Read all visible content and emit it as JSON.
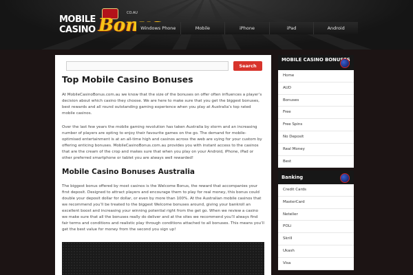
{
  "logo": {
    "line1": "MOBILE",
    "line2": "CASINO",
    "big": "Bonus",
    "cc": "CO.AU"
  },
  "nav": {
    "items": [
      "Windows Phone",
      "Mobile",
      "iPhone",
      "iPad",
      "Android"
    ]
  },
  "search": {
    "placeholder": "",
    "button_label": "Search"
  },
  "content": {
    "title": "Top Mobile Casino Bonuses",
    "p1": "At MobileCasinoBonus.com.au we know that the size of the bonuses on offer often influences a player’s decision about which casino they choose. We are here to make sure that you get the biggest bonuses, best rewards and all round outstanding gaming experience when you play at Australia’s top rated mobile casinos.",
    "p2": "Over the last few years the mobile gaming revolution has taken Australia by storm and an increasing number of players are opting to enjoy their favourite games on the go. The demand for mobile-optimised entertainment is at an all-time high and casinos across the web are vying for your custom by offering enticing bonuses. MobileCasinoBonus.com.au provides you with instant access to the casinos that are the cream of the crop and makes sure that when you play on your Android, iPhone, iPad or other preferred smartphone or tablet you are always well rewarded!",
    "subtitle": "Mobile Casino Bonuses Australia",
    "p3": "The biggest bonus offered by most casinos is the Welcome Bonus, the reward that accompanies your first deposit. Designed to attract players and encourage them to play for real money, this bonus could double your deposit dollar for dollar, or even by more than 100%. At the Australian mobile casinos that we recommend you’ll be treated to the biggest Welcome bonuses around, giving your bankroll an excellent boost and increasing your winning potential right from the get go. When we review a casino we make sure that all the bonuses really do deliver and at the sites we recommend you’ll always find fair terms and conditions and realistic play through conditions attached to all bonuses. This means you’ll get the best value for money from the second you sign up!"
  },
  "sidebar": {
    "bonuses": {
      "title": "MOBILE CASINO BONUSES",
      "items": [
        "Home",
        "AUD",
        "Bonuses",
        "Free",
        "Free Spins",
        "No Deposit",
        "Real Money",
        "Best"
      ]
    },
    "banking": {
      "title": "Banking",
      "items": [
        "Credit Cards",
        "MasterCard",
        "Neteller",
        "POLi",
        "Skrill",
        "Ukash",
        "Visa"
      ]
    }
  },
  "colors": {
    "accent": "#d8342c",
    "header_bg": "#151515",
    "page_bg": "#1c1414"
  }
}
